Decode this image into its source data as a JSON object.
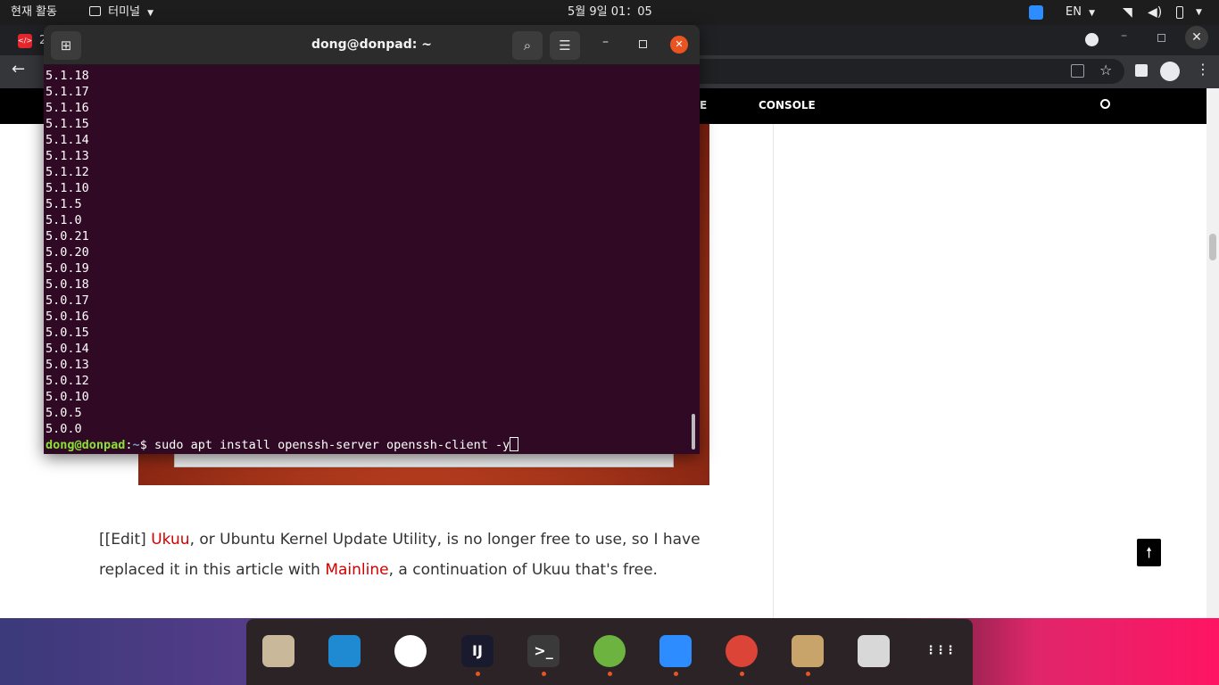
{
  "topbar": {
    "activities": "현재 활동",
    "app_menu": "터미널",
    "clock": "5월 9일  01：05",
    "input_lang": "EN"
  },
  "browser": {
    "tab_partial": "2",
    "nav_partial": "E",
    "nav_console": "CONSOLE",
    "scroll_top_glyph": "🠕",
    "paragraph": {
      "l1_pre": "[[Edit] ",
      "l1_link": "Ukuu",
      "l1_post": ", or Ubuntu Kernel Update Utility, is no longer free to use, so I have",
      "l2_pre": "replaced it in this article with ",
      "l2_link": "Mainline",
      "l2_post": ", a continuation of Ukuu that's free."
    }
  },
  "terminal": {
    "title": "dong@donpad: ~",
    "output_lines": [
      "5.1.18",
      "5.1.17",
      "5.1.16",
      "5.1.15",
      "5.1.14",
      "5.1.13",
      "5.1.12",
      "5.1.10",
      "5.1.5",
      "5.1.0",
      "5.0.21",
      "5.0.20",
      "5.0.19",
      "5.0.18",
      "5.0.17",
      "5.0.16",
      "5.0.15",
      "5.0.14",
      "5.0.13",
      "5.0.12",
      "5.0.10",
      "5.0.5",
      "5.0.0"
    ],
    "prompt_user": "dong@donpad",
    "prompt_sep": ":",
    "prompt_path": "~",
    "prompt_symbol": "$ ",
    "command": "sudo apt install openssh-server openssh-client -y"
  },
  "dock": {
    "items": [
      {
        "name": "files",
        "running": false,
        "color": "#c9b99a"
      },
      {
        "name": "vscode",
        "running": false,
        "color": "#1f8ad2"
      },
      {
        "name": "slack",
        "running": false,
        "color": "#ffffff"
      },
      {
        "name": "intellij",
        "running": true,
        "color": "#1a1a2e"
      },
      {
        "name": "terminal",
        "running": true,
        "color": "#3a3a3a"
      },
      {
        "name": "spring-tool-suite",
        "running": true,
        "color": "#6db33f"
      },
      {
        "name": "zoom",
        "running": true,
        "color": "#2d8cff"
      },
      {
        "name": "chrome",
        "running": true,
        "color": "#db4437"
      },
      {
        "name": "software-installer",
        "running": true,
        "color": "#c8a46a"
      },
      {
        "name": "trash",
        "running": false,
        "color": "#d8d8d8"
      },
      {
        "name": "show-applications",
        "running": false,
        "color": "#2b2326"
      }
    ],
    "labels": {
      "intellij": "IJ",
      "terminal": ">_"
    }
  }
}
